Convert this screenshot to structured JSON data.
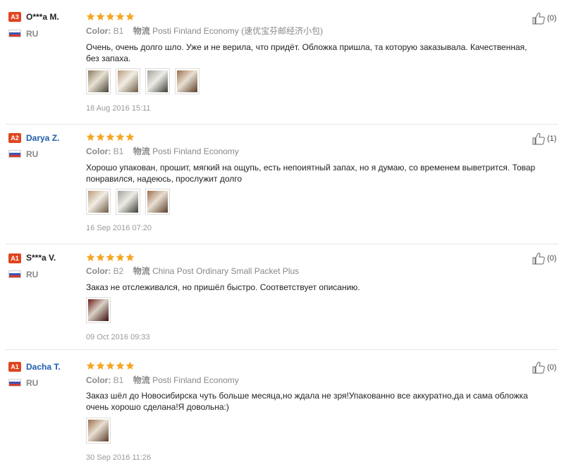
{
  "colors": {
    "badge": "#e0451f",
    "link_name": "#1d5dad",
    "star": "#f5a623",
    "divider": "#e6e6e6"
  },
  "icons": {
    "star": "star-icon",
    "thumb": "thumbs-up-icon",
    "flag": "russia-flag-icon"
  },
  "labels": {
    "color": "Color:",
    "logistics": "物流"
  },
  "reviews": [
    {
      "level": "A3",
      "name": "O***a M.",
      "country": "RU",
      "rating": 5,
      "color_value": "B1",
      "logistics_value": "Posti Finland Economy (速优宝芬邮经济小包)",
      "text": "Очень, очень долго шло. Уже и не верила, что придёт. Обложка пришла, та которую заказывала. Качественная, без запаха.",
      "photo_count": 4,
      "date": "18 Aug 2016 15:11",
      "helpful": "(0)"
    },
    {
      "level": "A2",
      "name": "Darya Z.",
      "country": "RU",
      "rating": 5,
      "color_value": "B1",
      "logistics_value": "Posti Finland Economy",
      "text": "Хорошо упакован, прошит, мягкий на ощупь, есть непоиятный запах, но я думаю, со временем выветрится. Товар понравился, надеюсь, прослужит долго",
      "photo_count": 3,
      "date": "16 Sep 2016 07:20",
      "helpful": "(1)"
    },
    {
      "level": "A1",
      "name": "S***a V.",
      "country": "RU",
      "rating": 5,
      "color_value": "B2",
      "logistics_value": "China Post Ordinary Small Packet Plus",
      "text": "Заказ не отслеживался, но пришёл быстро. Соответствует описанию.",
      "photo_count": 1,
      "date": "09 Oct 2016 09:33",
      "helpful": "(0)"
    },
    {
      "level": "A1",
      "name": "Dacha T.",
      "country": "RU",
      "rating": 5,
      "color_value": "B1",
      "logistics_value": "Posti Finland Economy",
      "text": "Заказ шёл до Новосибирска чуть больше месяца,но ждала не зря!Упакованно все аккуратно,да и сама обложка очень хорошо сделана!Я довольна:)",
      "photo_count": 1,
      "date": "30 Sep 2016 11:26",
      "helpful": "(0)"
    }
  ]
}
